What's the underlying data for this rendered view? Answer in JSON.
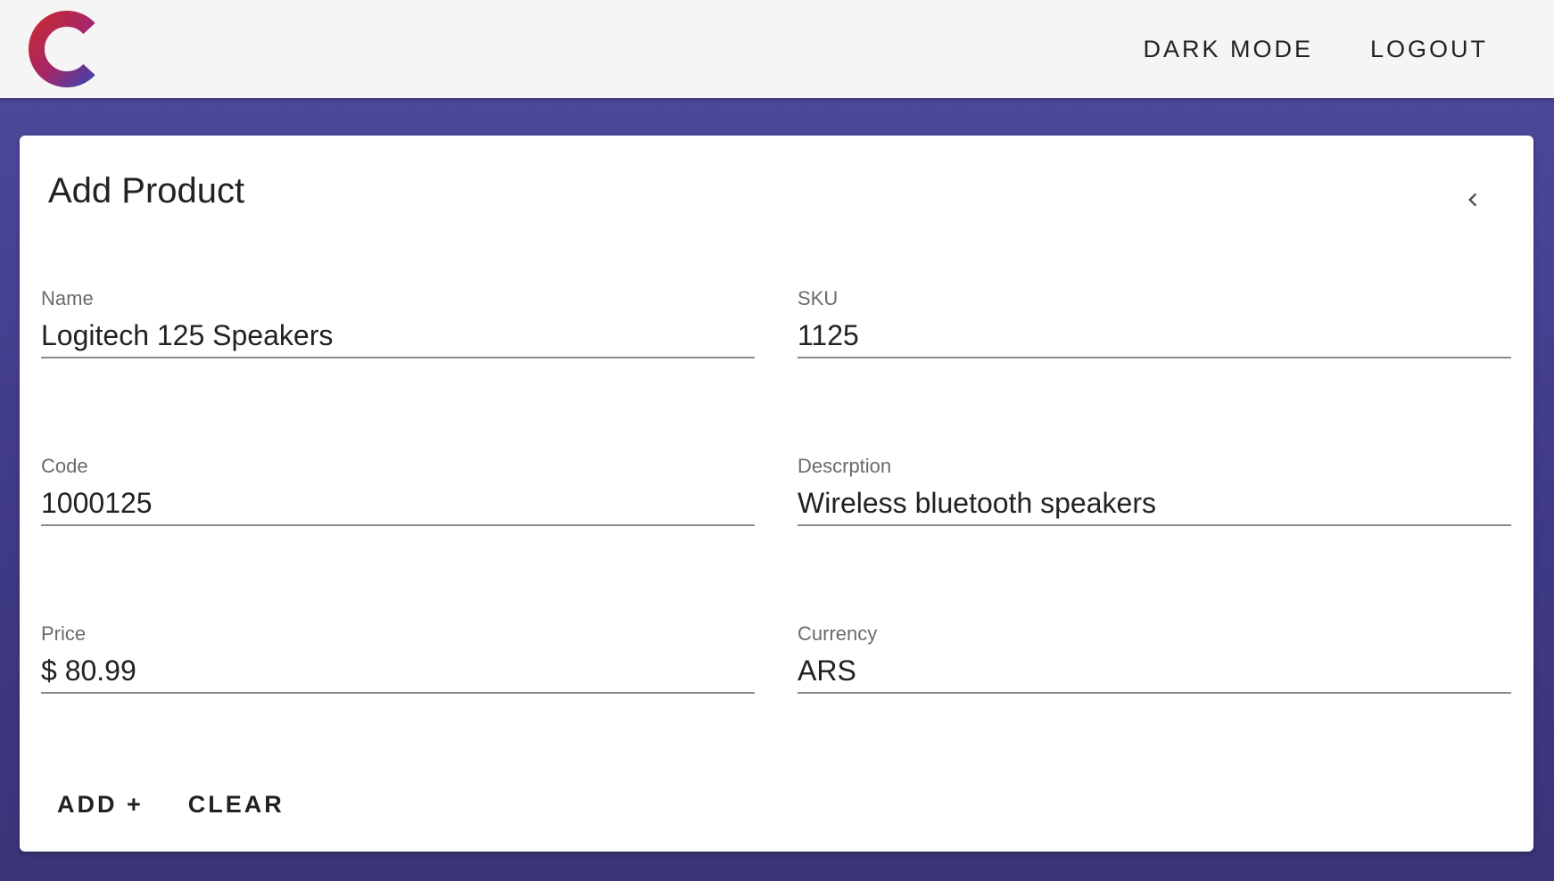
{
  "topbar": {
    "dark_mode_label": "DARK MODE",
    "logout_label": "LOGOUT",
    "logo_colors": [
      "#c62a35",
      "#7a2f8a",
      "#4a3fa3"
    ]
  },
  "card": {
    "title": "Add Product",
    "back_icon": "chevron-left-icon",
    "fields": {
      "name": {
        "label": "Name",
        "value": "Logitech 125 Speakers"
      },
      "sku": {
        "label": "SKU",
        "value": "1125"
      },
      "code": {
        "label": "Code",
        "value": "1000125"
      },
      "description": {
        "label": "Descrption",
        "value": "Wireless bluetooth speakers"
      },
      "price": {
        "label": "Price",
        "value": "$ 80.99"
      },
      "currency": {
        "label": "Currency",
        "value": "ARS"
      }
    },
    "actions": {
      "add_label": "ADD +",
      "clear_label": "CLEAR"
    }
  },
  "colors": {
    "background": "#4a4596",
    "topbar": "#f5f5f5",
    "card": "#ffffff"
  }
}
